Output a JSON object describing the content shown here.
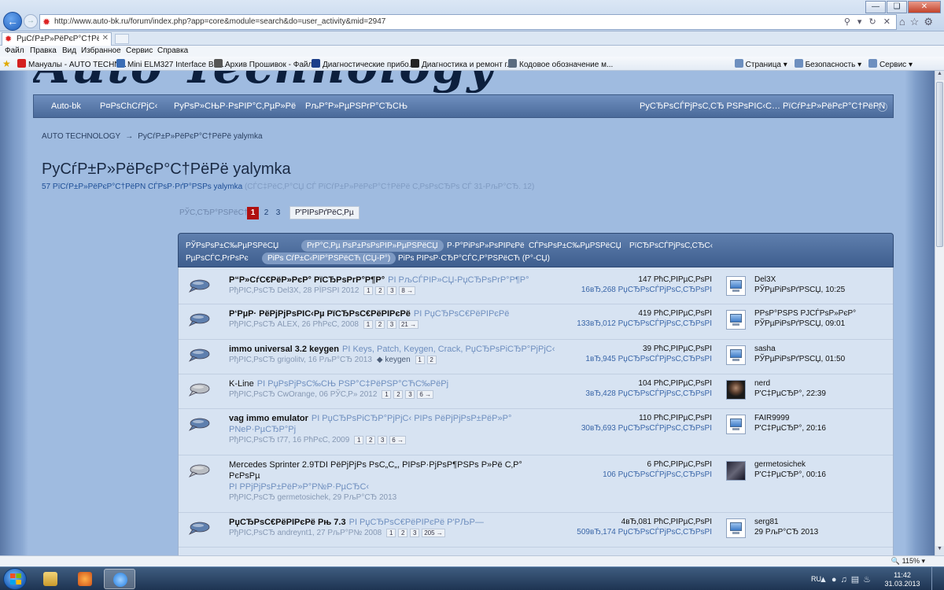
{
  "browser": {
    "url": "http://www.auto-bk.ru/forum/index.php?app=core&module=search&do=user_activity&mid=2947",
    "tab_title": "PµCѓP±P»PёPєP°C†PёPё y...",
    "menu": [
      "Файл",
      "Правка",
      "Вид",
      "Избранное",
      "Сервис",
      "Справка"
    ],
    "favorites": [
      {
        "label": "Мануалы - AUTO TECHN...",
        "color": "#d42020"
      },
      {
        "label": "Mini ELM327 Interface Blu...",
        "color": "#3a6db5"
      },
      {
        "label": "Архив Прошивок - Файл...",
        "color": "#555555"
      },
      {
        "label": "Диагностические прибо...",
        "color": "#1b3e8a"
      },
      {
        "label": "Диагностика и ремонт г...",
        "color": "#222222"
      },
      {
        "label": "Кодовое обозначение м...",
        "color": "#5b6c80"
      }
    ],
    "command_bar": [
      "Страница",
      "Безопасность",
      "Сервис"
    ],
    "zoom": "115%"
  },
  "site": {
    "logo_text": "Auto Technology",
    "nav": [
      {
        "label": "Auto-bk"
      },
      {
        "label": "P¤PsChCŕPjC‹"
      },
      {
        "label": "PyPsP»CЊP·PsPIP°C‚PµP»Pё"
      },
      {
        "label": "PљP°P»PµPSPrP°CЂCЊ"
      },
      {
        "label": "PyCЂPsCЃPjPsC‚CЂ PSPsPIC‹C… PїCѓP±P»PёPєP°C†PёPN"
      }
    ],
    "breadcrumb": [
      "AUTO TECHNOLOGY",
      "PyCѓP±P»PёPєP°C†PёPё yalymka"
    ],
    "page_title": "PyCѓP±P»PёPєP°C†PёPё yalymka",
    "subtitle_count": "57 PїCѓP±P»PёPєP°C†PёPN CЃPѕP·PґP°PSPs yalymka",
    "subtitle_note": "(CЃC‡PёC‚P°CЏ CЃ PїCѓP±P»PёPєP°C†PёPё C‚PsPsCЂPs CЃ 31-PљP°CЂ. 12)",
    "pager": {
      "label": "РЎС‚СЂР°РЅРёС†",
      "pages": [
        "1",
        "2",
        "3"
      ],
      "current": "1",
      "more": "Р'РІРѕРґРёС‚Рµ"
    },
    "filter_tabs": [
      {
        "label": "РЎРѕРѕР±С‰РµРЅРёСЏ",
        "active": false
      },
      {
        "label": "PrP°C‚Pµ PsP±PsPsPIP»PµPSPёCЏ",
        "active": true
      },
      {
        "label": "P·P°PiPsP»PsPIPєPё",
        "active": false
      },
      {
        "label": "CЃPsPsP±C‰PµPSPёCЏ",
        "active": false
      },
      {
        "label": "PїCЂPsCЃPjPsC‚CЂC‹",
        "active": false
      },
      {
        "label": "PµPsCЃC‚PrPsPє",
        "active": false
      },
      {
        "label": "PiPs CѓP±C‹PIP°PSPёCЋ (CЏ-P°)",
        "active": true
      },
      {
        "label": "PiPs PIPsP·CЂP°CЃC‚P°PSPёCЋ (P°-CЏ)",
        "active": false
      }
    ]
  },
  "topics": [
    {
      "title": "P“P»CѓC€PёP»PєP° PїCЂPsPrP°P¶P°",
      "in": "PI PљCЃPIP»CЏ-PџCЂPsPrP°P¶P°",
      "meta": "PђPIC‚PsCЂ Del3X, 28 PЇPSPI 2012",
      "pages": [
        "1",
        "2",
        "3",
        "8 →"
      ],
      "tag": "",
      "replies": "147 PћC‚PIPµC‚PsPI",
      "views": "16вЂ‚268 PџCЂPsCЃPjPsC‚CЂPsPI",
      "avatar": "screen",
      "last_user": "Del3X",
      "last_time": "PЎPµPiPsPґPSCЏ, 10:25",
      "bold": true,
      "read": false
    },
    {
      "title": "P‘PµP· PёPjPjPsPIC‹Pµ PїCЂPsC€PёPIPєPё",
      "in": "PI PџCЂPsC€PёPIPєPё",
      "meta": "PђPIC‚PsCЂ ALEX, 26 PћPєC‚ 2008",
      "pages": [
        "1",
        "2",
        "3",
        "21 →"
      ],
      "tag": "",
      "replies": "419 PћC‚PIPµC‚PsPI",
      "views": "133вЂ‚012 PџCЂPsCЃPjPsC‚CЂPsPI",
      "avatar": "screen",
      "last_user": "PPsP°PSPS PJCЃPsP»PєP°",
      "last_time": "PЎPµPiPsPґPSCЏ, 09:01",
      "bold": true,
      "read": false
    },
    {
      "title": "immo universal 3.2 keygen",
      "in": "PI Keys, Patch, Keygen, Crack, PџCЂPsPiCЂP°PjPjC‹",
      "meta": "PђPIC‚PsCЂ grigolitv, 16 PљP°CЂ 2013",
      "pages": [
        "1",
        "2"
      ],
      "tag": "keygen",
      "replies": "39 PћC‚PIPµC‚PsPI",
      "views": "1вЂ‚945 PџCЂPsCЃPjPsC‚CЂPsPI",
      "avatar": "screen",
      "last_user": "sasha",
      "last_time": "PЎPµPiPsPґPSCЏ, 01:50",
      "bold": true,
      "read": false
    },
    {
      "title": "K-Line",
      "in": "PI PџPsPjPsC‰CЊ PSP°C‡PёPSP°CЋC‰PёPj",
      "meta": "PђPIC‚PsCЂ CwOrange, 06 PЎC‚P» 2012",
      "pages": [
        "1",
        "2",
        "3",
        "6 →"
      ],
      "tag": "",
      "replies": "104 PћC‚PIPµC‚PsPI",
      "views": "3вЂ‚428 PџCЂPsCЃPjPsC‚CЂPsPI",
      "avatar": "photo",
      "last_user": "nerd",
      "last_time": "P'C‡PµCЂP°, 22:39",
      "bold": false,
      "read": true
    },
    {
      "title": "vag immo emulator",
      "in": "PI PџCЂPsPiCЂP°PjPjC‹ PIPs PёPjPjPsP±PёP»P°",
      "title2": "PNeP·PµCЂP°Pj",
      "meta": "PђPIC‚PsCЂ t77, 16 PћPєC‚ 2009",
      "pages": [
        "1",
        "2",
        "3",
        "6 →"
      ],
      "tag": "",
      "replies": "110 PћC‚PIPµC‚PsPI",
      "views": "30вЂ‚693 PџCЂPsCЃPjPsC‚CЂPsPI",
      "avatar": "screen",
      "last_user": "FAIR9999",
      "last_time": "P'C‡PµCЂP°, 20:16",
      "bold": true,
      "read": false
    },
    {
      "title": "Mercedes Sprinter 2.9TDI PёPjPjPs PsC„C„, PIPsP·PjPsP¶PSPs P»Pё C‚P°",
      "title2": "PєPsPµ",
      "in": "PI PPjPjPsP±PёP»P°P№P·PµCЂC‹",
      "meta": "PђPIC‚PsCЂ germetosichek, 29 PљP°CЂ 2013",
      "pages": [],
      "tag": "",
      "replies": "6 PћC‚PIPµC‚PsPI",
      "views": "106 PџCЂPsCЃPjPsC‚CЂPsPI",
      "avatar": "car",
      "last_user": "germetosichek",
      "last_time": "P'C‡PµCЂP°, 00:16",
      "bold": false,
      "read": true
    },
    {
      "title": "PџCЂPsC€PёPIPєPё Pњ 7.3",
      "in": "PI PџCЂPsC€PёPIPєPё P'PЉP—",
      "meta": "PђPIC‚PsCЂ andreynt1, 27 PљP°P№ 2008",
      "pages": [
        "1",
        "2",
        "3",
        "205 →"
      ],
      "tag": "",
      "replies": "4вЂ‚081 PћC‚PIPµC‚PsPI",
      "views": "509вЂ‚174 PџCЂPsCЃPjPsC‚CЂPsPI",
      "avatar": "screen",
      "last_user": "serg81",
      "last_time": "29 PљP°CЂ 2013",
      "bold": true,
      "read": false
    }
  ],
  "taskbar": {
    "lang": "RU",
    "time": "11:42",
    "date": "31.03.2013"
  },
  "colors": {
    "accent": "#b01010",
    "nav": "#4a6a9a",
    "link": "#3a66a8"
  }
}
